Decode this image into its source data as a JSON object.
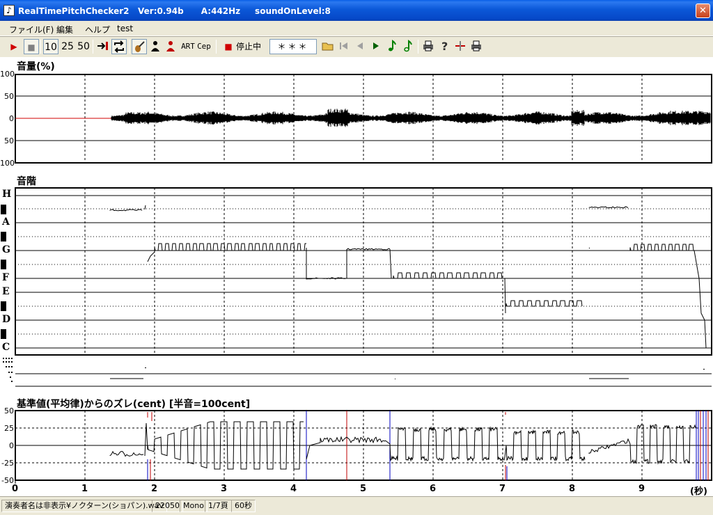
{
  "window": {
    "title": "RealTimePitchChecker2   Ver:0.94b      A:442Hz     soundOnLevel:8",
    "close_glyph": "✕"
  },
  "menu": [
    "ファイル(F)",
    "編集",
    "ヘルプ",
    "test"
  ],
  "toolbar": {
    "play": "▶",
    "stop": "■",
    "speed_10": "10",
    "speed_25": "25",
    "speed_50": "50",
    "rec_glyph": "■",
    "status": "停止中",
    "note_display": "＊＊＊",
    "art_label": "ART",
    "cep_label": "Cep"
  },
  "sections": {
    "volume_title": "音量(%)",
    "scale_title": "音階",
    "deviation_title": "基準値(平均律)からのズレ(cent) [半音=100cent]"
  },
  "volume_axis": [
    "100",
    "50",
    "0",
    "50",
    "100"
  ],
  "note_labels": [
    "H",
    "A",
    "G",
    "F",
    "E",
    "D",
    "C"
  ],
  "cent_axis": [
    "50",
    "25",
    "0",
    "-25",
    "-50"
  ],
  "time_axis": {
    "ticks": [
      "0",
      "1",
      "2",
      "3",
      "4",
      "5",
      "6",
      "7",
      "8",
      "9"
    ],
    "unit": "(秒)"
  },
  "statusbar": {
    "file": "演奏者名は非表示¥ノクターン(ショパン).wav",
    "rate": "22050",
    "channels": "Mono",
    "page": "1/7頁",
    "length": "60秒"
  },
  "colors": {
    "title_blue": "#0A5FE6",
    "marker_blue": "#0000C0",
    "marker_red": "#C00000",
    "trace": "#000000",
    "baseline_red": "#D00000"
  }
}
